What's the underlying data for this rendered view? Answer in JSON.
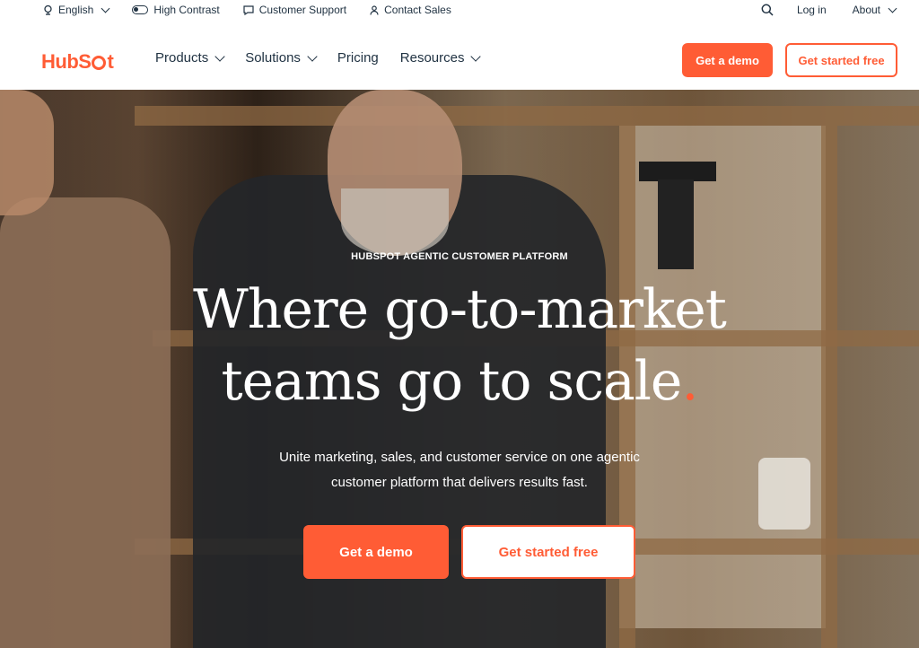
{
  "utility_bar": {
    "language": "English",
    "high_contrast": "High Contrast",
    "customer_support": "Customer Support",
    "contact_sales": "Contact Sales",
    "login": "Log in",
    "about": "About"
  },
  "nav": {
    "logo_text_a": "HubS",
    "logo_text_b": "t",
    "items": [
      {
        "label": "Products",
        "has_dropdown": true
      },
      {
        "label": "Solutions",
        "has_dropdown": true
      },
      {
        "label": "Pricing",
        "has_dropdown": false
      },
      {
        "label": "Resources",
        "has_dropdown": true
      }
    ],
    "demo_button": "Get a demo",
    "free_button": "Get started free"
  },
  "hero": {
    "eyebrow": "HUBSPOT AGENTIC CUSTOMER PLATFORM",
    "headline_line1": "Where go-to-market",
    "headline_line2": "teams go to scale",
    "headline_dot": ".",
    "subcopy": "Unite marketing, sales, and customer service on one agentic customer platform that delivers results fast.",
    "demo_button": "Get a demo",
    "free_button": "Get started free"
  },
  "colors": {
    "brand_orange": "#ff5c35",
    "text_dark": "#213343"
  }
}
